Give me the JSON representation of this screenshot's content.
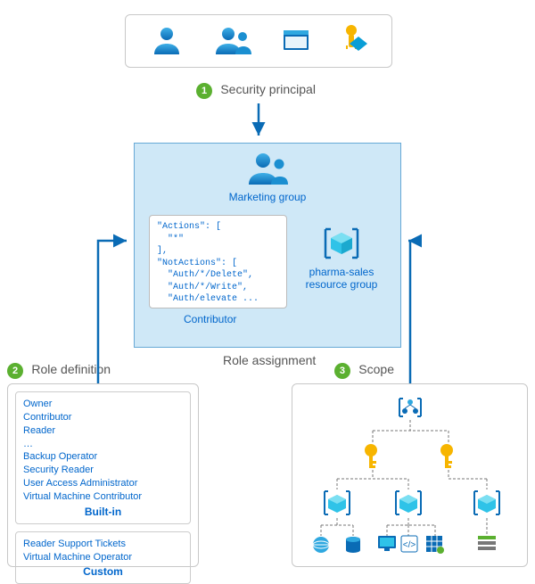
{
  "labels": {
    "security_principal": "Security principal",
    "role_assignment": "Role assignment",
    "role_definition": "Role definition",
    "scope": "Scope",
    "marketing_group": "Marketing group",
    "contributor": "Contributor",
    "resource_group_name": "pharma-sales",
    "resource_group_word": "resource group",
    "builtin": "Built-in",
    "custom": "Custom",
    "ellipsis": "…"
  },
  "numbers": {
    "one": "1",
    "two": "2",
    "three": "3"
  },
  "code_lines": {
    "l1": "\"Actions\": [",
    "l2": "  \"*\"",
    "l3": "],",
    "l4": "\"NotActions\": [",
    "l5": "  \"Auth/*/Delete\",",
    "l6": "  \"Auth/*/Write\",",
    "l7": "  \"Auth/elevate ..."
  },
  "builtin_roles": {
    "r1": "Owner",
    "r2": "Contributor",
    "r3": "Reader",
    "r5": "Backup Operator",
    "r6": "Security Reader",
    "r7": "User Access Administrator",
    "r8": "Virtual Machine Contributor"
  },
  "custom_roles": {
    "r1": "Reader Support Tickets",
    "r2": "Virtual Machine Operator"
  },
  "principals_icons": [
    "user",
    "group",
    "service-principal",
    "managed-identity"
  ],
  "scope_tree": {
    "root": "management-group",
    "subscriptions": 2,
    "resource_groups": 3,
    "resources": 6
  }
}
